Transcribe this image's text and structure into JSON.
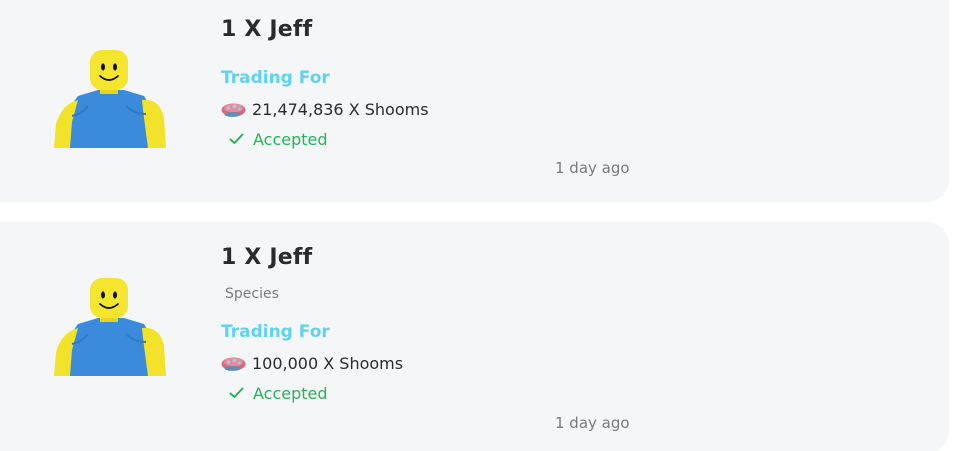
{
  "trades": [
    {
      "title": "1 X Jeff",
      "trading_for_label": "Trading For",
      "offer": {
        "icon": "shoom-icon",
        "text": "21,474,836 X Shooms"
      },
      "status": "Accepted",
      "time_ago": "1 day ago"
    },
    {
      "title": "1 X Jeff",
      "category": "Species",
      "trading_for_label": "Trading For",
      "offer": {
        "icon": "shoom-icon",
        "text": "100,000 X Shooms"
      },
      "status": "Accepted",
      "time_ago": "1 day ago"
    }
  ],
  "colors": {
    "card_background": "#f5f6f7",
    "title": "#2b2b2b",
    "trading_for": "#5fd3ee",
    "accepted": "#22b45a",
    "muted": "#777b80"
  }
}
